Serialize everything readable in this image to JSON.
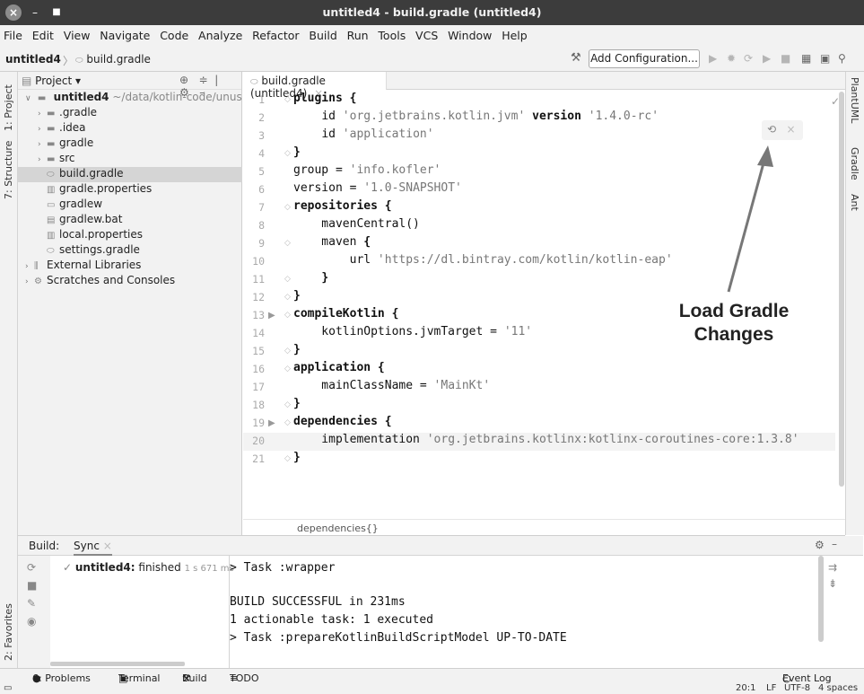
{
  "window": {
    "title": "untitled4 - build.gradle (untitled4)"
  },
  "menu": [
    "File",
    "Edit",
    "View",
    "Navigate",
    "Code",
    "Analyze",
    "Refactor",
    "Build",
    "Run",
    "Tools",
    "VCS",
    "Window",
    "Help"
  ],
  "nav": {
    "project": "untitled4",
    "sep": "〉",
    "file": "build.gradle",
    "add_config": "Add Configuration..."
  },
  "left_strip": {
    "project": "1: Project",
    "structure": "7: Structure",
    "favorites": "2: Favorites"
  },
  "right_strip": {
    "plantuml": "PlantUML",
    "gradle": "Gradle",
    "ant": "Ant"
  },
  "project_panel": {
    "title": "Project ▾",
    "root_name": "untitled4",
    "root_path": "~/data/kotlin-code/unuse",
    "items": [
      {
        "label": ".gradle"
      },
      {
        "label": ".idea"
      },
      {
        "label": "gradle"
      },
      {
        "label": "src"
      },
      {
        "label": "build.gradle"
      },
      {
        "label": "gradle.properties"
      },
      {
        "label": "gradlew"
      },
      {
        "label": "gradlew.bat"
      },
      {
        "label": "local.properties"
      },
      {
        "label": "settings.gradle"
      },
      {
        "label": "External Libraries"
      },
      {
        "label": "Scratches and Consoles"
      }
    ]
  },
  "editor": {
    "tab_label": "build.gradle (untitled4)",
    "tab_close": "×",
    "line_numbers": [
      "1",
      "2",
      "3",
      "4",
      "5",
      "6",
      "7",
      "8",
      "9",
      "10",
      "11",
      "12",
      "13",
      "14",
      "15",
      "16",
      "17",
      "18",
      "19",
      "20",
      "21"
    ],
    "lines": [
      {
        "kw": "plugins {",
        "rest": ""
      },
      {
        "indent": "    ",
        "a": "id ",
        "s": "'org.jetbrains.kotlin.jvm'",
        "b": " version ",
        "s2": "'1.4.0-rc'"
      },
      {
        "indent": "    ",
        "a": "id ",
        "s": "'application'",
        "b": "",
        "s2": ""
      },
      {
        "kw": "}",
        "rest": ""
      },
      {
        "plain": "group = ",
        "s": "'info.kofler'"
      },
      {
        "plain": "version = ",
        "s": "'1.0-SNAPSHOT'"
      },
      {
        "kw": "repositories {",
        "rest": ""
      },
      {
        "plain": "    mavenCentral()",
        "s": ""
      },
      {
        "plain": "    maven ",
        "s": "",
        "kwtail": "{"
      },
      {
        "plain": "        url ",
        "s": "'https://dl.bintray.com/kotlin/kotlin-eap'"
      },
      {
        "plain": "    ",
        "s": "",
        "kwtail": "}"
      },
      {
        "kw": "}",
        "rest": ""
      },
      {
        "kw": "compileKotlin {",
        "rest": ""
      },
      {
        "plain": "    kotlinOptions.jvmTarget = ",
        "s": "'11'"
      },
      {
        "kw": "}",
        "rest": ""
      },
      {
        "kw": "application {",
        "rest": ""
      },
      {
        "plain": "    mainClassName = ",
        "s": "'MainKt'"
      },
      {
        "kw": "}",
        "rest": ""
      },
      {
        "kw": "dependencies {",
        "rest": ""
      },
      {
        "plain": "    implementation ",
        "s": "'org.jetbrains.kotlinx:kotlinx-coroutines-core:1.3.8'"
      },
      {
        "kw": "}",
        "rest": ""
      }
    ],
    "breadcrumb": "dependencies{}",
    "current_line": 20
  },
  "annotation": {
    "line1": "Load Gradle",
    "line2": "Changes"
  },
  "build": {
    "label": "Build:",
    "tab": "Sync",
    "tab_close": "×",
    "tree_item": "untitled4:",
    "tree_status": "finished",
    "tree_time": "1 s 671 ms",
    "console": [
      "> Task :wrapper",
      "",
      "BUILD SUCCESSFUL in 231ms",
      "1 actionable task: 1 executed",
      "> Task :prepareKotlinBuildScriptModel UP-TO-DATE"
    ]
  },
  "bottom_tabs": {
    "problems": "6: Problems",
    "terminal": "Terminal",
    "build": "Build",
    "todo": "TODO",
    "event_log": "Event Log"
  },
  "status": {
    "position": "20:1",
    "line_sep": "LF",
    "encoding": "UTF-8",
    "indent": "4 spaces"
  }
}
